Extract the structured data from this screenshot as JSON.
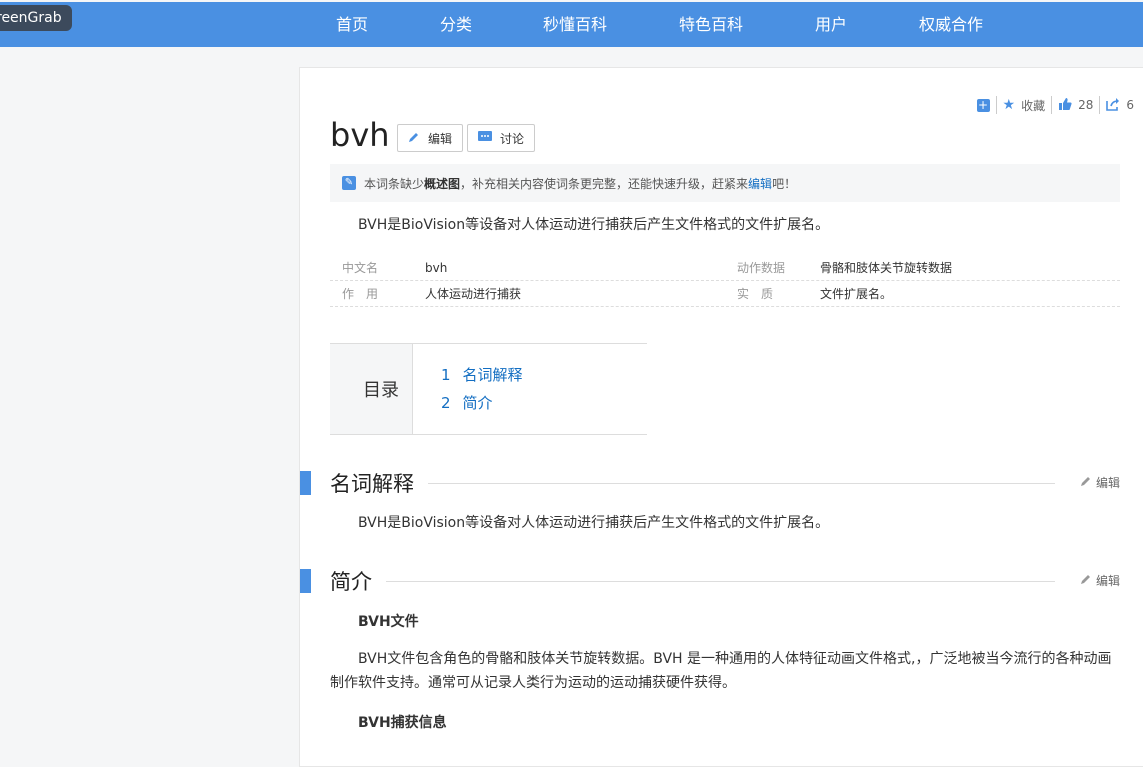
{
  "overlay": {
    "label": "reenGrab"
  },
  "nav": {
    "items": [
      "首页",
      "分类",
      "秒懂百科",
      "特色百科",
      "用户",
      "权威合作"
    ]
  },
  "tools": {
    "collect": "收藏",
    "likes": "28",
    "shares": "6"
  },
  "title": "bvh",
  "buttons": {
    "edit": "编辑",
    "discuss": "讨论"
  },
  "tip": {
    "pre": "本词条缺少",
    "bold": "概述图",
    "mid": "，补充相关内容使词条更完整，还能快速升级，赶紧来",
    "link": "编辑",
    "post": "吧！"
  },
  "summary": "BVH是BioVision等设备对人体运动进行捕获后产生文件格式的文件扩展名。",
  "basic_info": [
    {
      "k1": "中文名",
      "v1": "bvh",
      "k2": "动作数据",
      "v2": "骨骼和肢体关节旋转数据"
    },
    {
      "k1": "作　用",
      "v1": "人体运动进行捕获",
      "k2": "实　质",
      "v2": "文件扩展名。"
    }
  ],
  "toc": {
    "title": "目录",
    "items": [
      {
        "n": "1",
        "label": "名词解释"
      },
      {
        "n": "2",
        "label": "简介"
      }
    ]
  },
  "sections": [
    {
      "title": "名词解释",
      "edit": "编辑",
      "text": "BVH是BioVision等设备对人体运动进行捕获后产生文件格式的文件扩展名。"
    },
    {
      "title": "简介",
      "edit": "编辑"
    }
  ],
  "intro": {
    "sub1": "BVH文件",
    "para1": "BVH文件包含角色的骨骼和肢体关节旋转数据。BVH 是一种通用的人体特征动画文件格式,，广泛地被当今流行的各种动画制作软件支持。通常可从记录人类行为运动的运动捕获硬件获得。",
    "sub2": "BVH捕获信息"
  }
}
